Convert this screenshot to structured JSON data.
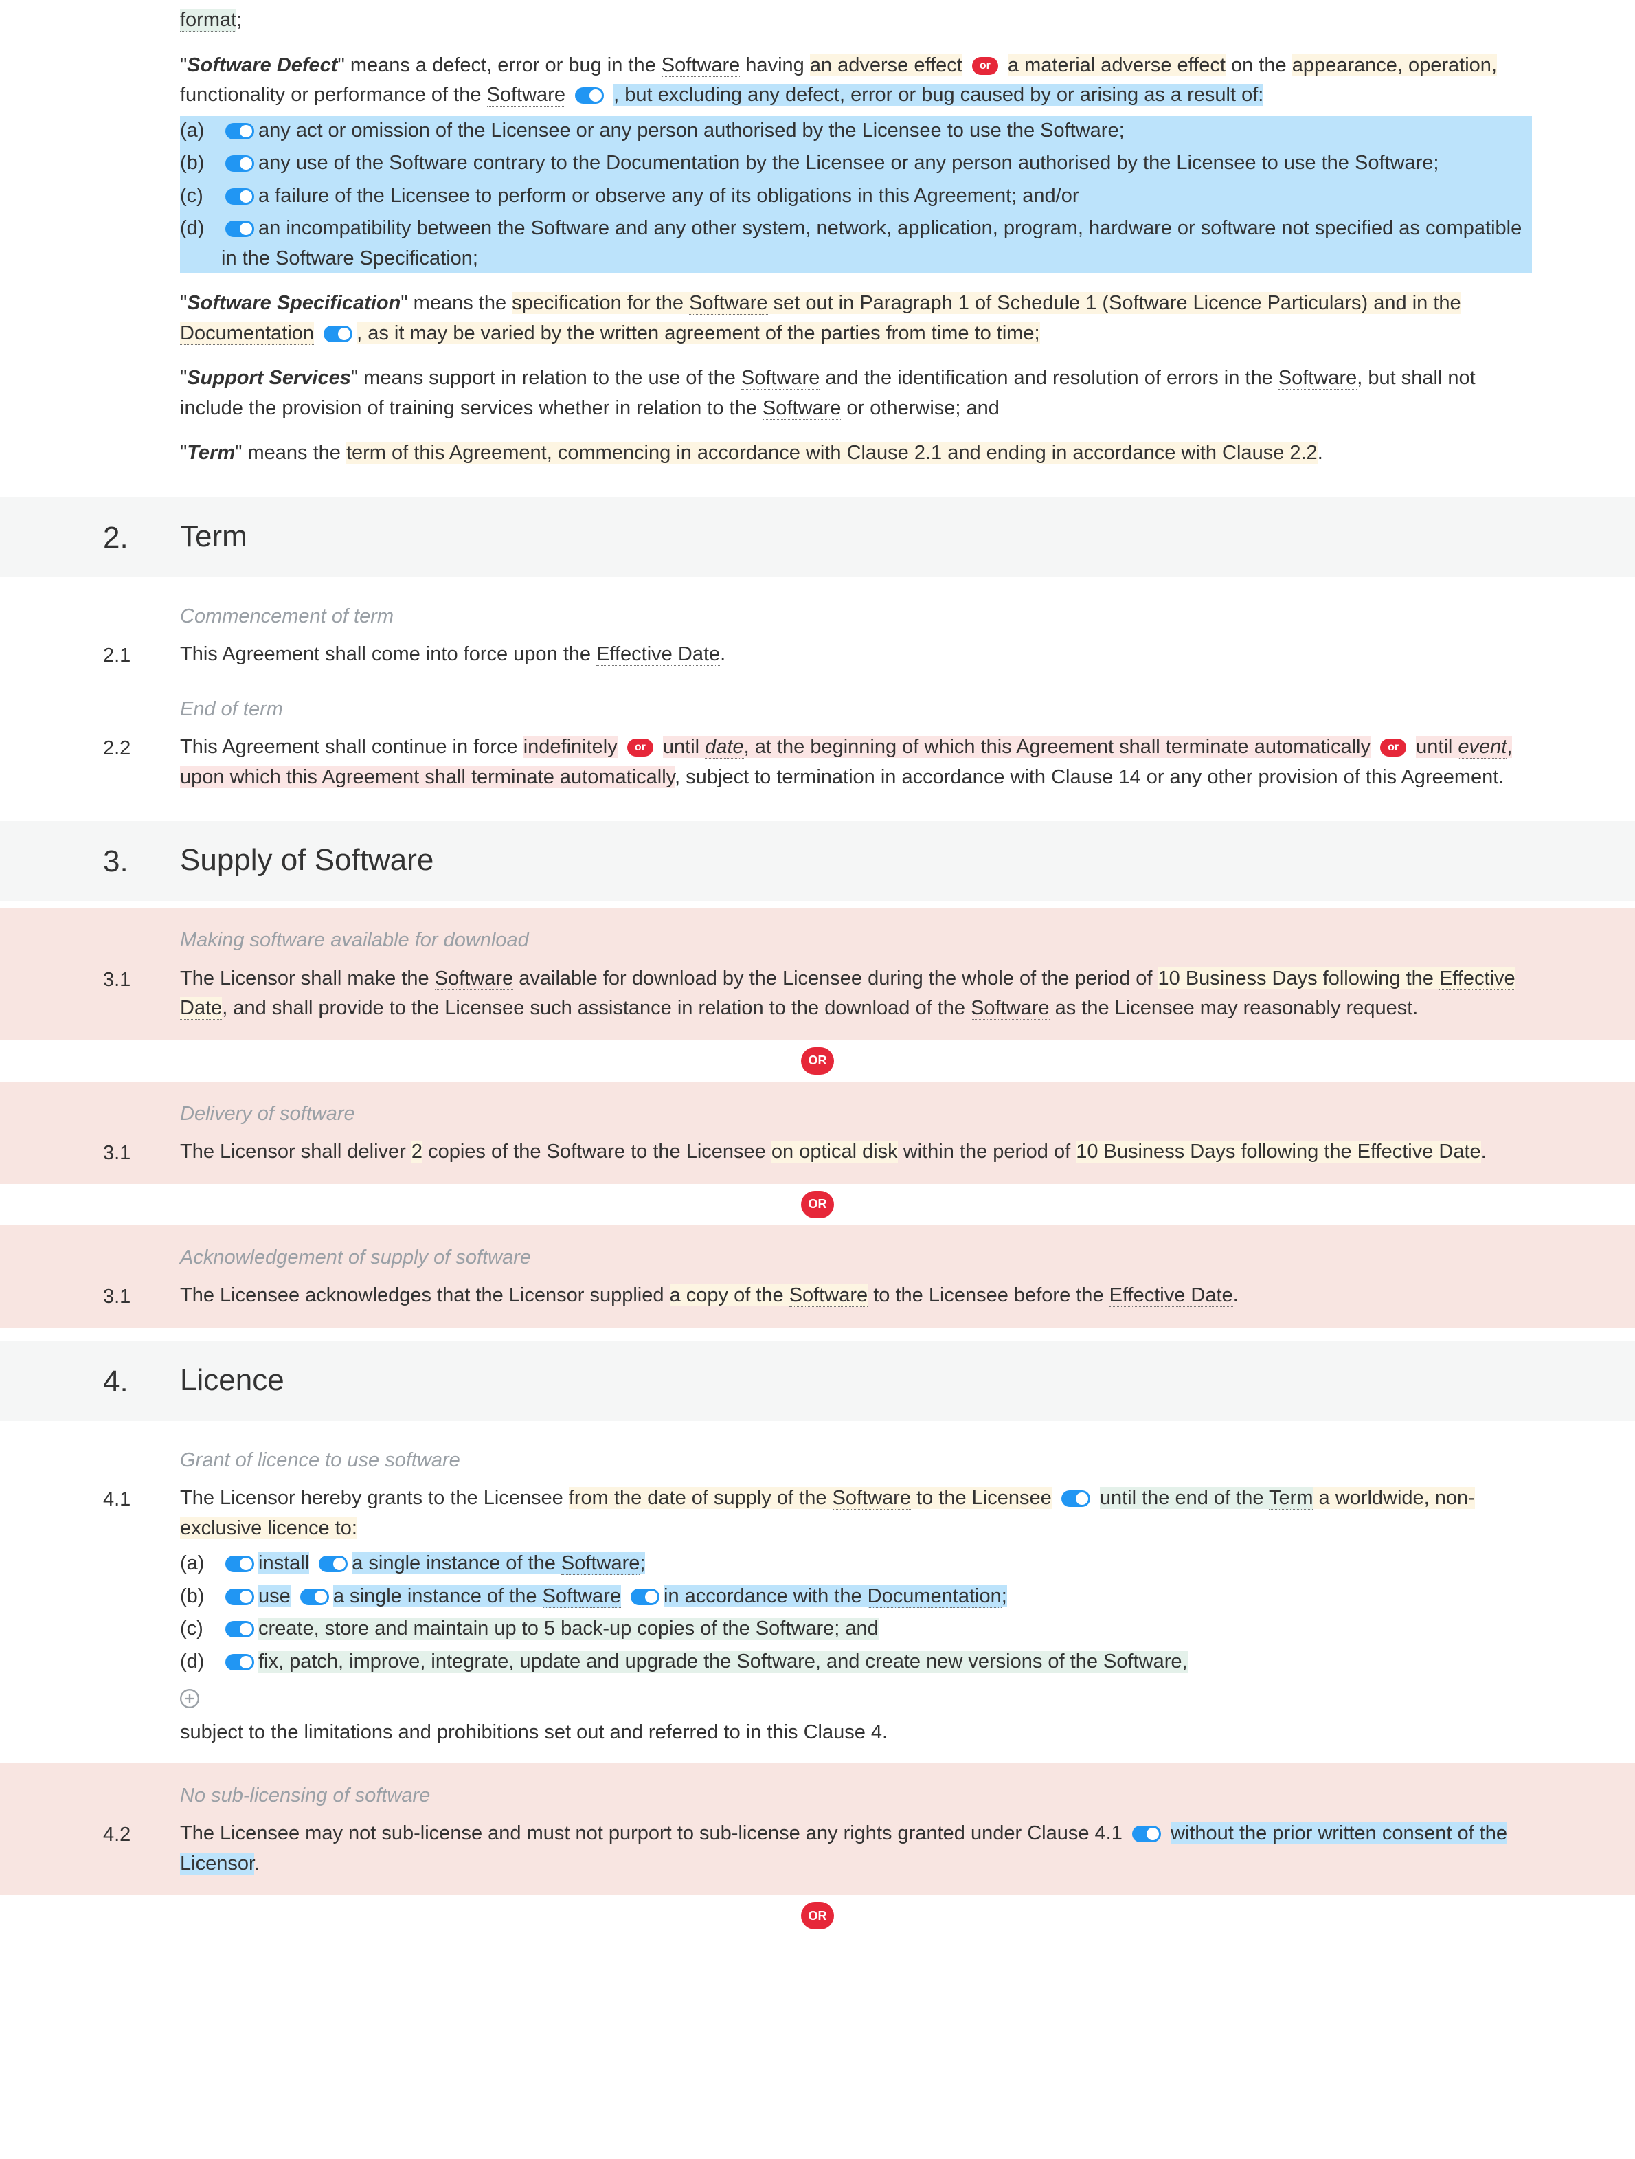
{
  "ui": {
    "or": "OR",
    "or_lc": "or"
  },
  "defs": {
    "format": "format",
    "sd": {
      "term": "Software Defect",
      "t1": "\" means a defect, error or bug in the ",
      "software1": "Software",
      "t2": " having ",
      "adverse": "an adverse effect",
      "material": "a material adverse effect",
      "t3": " on the ",
      "appearance": "appearance, operation,",
      "t4": " functionality or performance of the ",
      "software2": "Software",
      "t5": ", but excluding any defect, error or bug caused by or arising as a result of:",
      "a": {
        "label": "(a)",
        "text": "any act or omission of the Licensee or any person authorised by the Licensee to use the Software;"
      },
      "b": {
        "label": "(b)",
        "text": "any use of the Software contrary to the Documentation by the Licensee or any person authorised by the Licensee to use the Software;"
      },
      "c": {
        "label": "(c)",
        "text": "a failure of the Licensee to perform or observe any of its obligations in this Agreement; and/or"
      },
      "d": {
        "label": "(d)",
        "text": "an incompatibility between the Software and any other system, network, application, program, hardware or software not specified as compatible in the Software Specification;"
      }
    },
    "sspec": {
      "term": "Software Specification",
      "t1": "\" means the ",
      "spec": "specification for the ",
      "software": "Software",
      "setout": " set out in Paragraph 1 of Schedule 1 (Software Licence Particulars) and in the ",
      "doc": "Documentation",
      "t2": ", as it may be varied by the written agreement of the parties from time to time;"
    },
    "ss": {
      "term": "Support Services",
      "t1": "\" means support in relation to the use of the ",
      "sw1": "Software",
      "t2": " and the identification and resolution of errors in the ",
      "sw2": "Software",
      "t3": ", but shall not include the provision of training services whether in relation to the ",
      "sw3": "Software",
      "t4": " or otherwise; and"
    },
    "term": {
      "term": "Term",
      "t1": "\" means the ",
      "hl": "term of this Agreement, commencing in accordance with Clause 2.1 and ending in accordance with Clause 2.2",
      "t2": "."
    }
  },
  "s2": {
    "num": "2.",
    "title": "Term",
    "sub1": "Commencement of term",
    "c21": {
      "num": "2.1",
      "t1": "This Agreement shall come into force upon the ",
      "eff": "Effective Date",
      "t2": "."
    },
    "sub2": "End of term",
    "c22": {
      "num": "2.2",
      "t1": "This Agreement shall continue in force ",
      "indef": "indefinitely",
      "t2": " until ",
      "date": "date",
      "t3": ", at the beginning of which this Agreement shall terminate automatically",
      "t4": " until ",
      "event": "event",
      "t5": ", upon which this Agreement shall terminate automatically",
      "t6": ", subject to termination in accordance with Clause 14 or any other provision of this Agreement."
    }
  },
  "s3": {
    "num": "3.",
    "title_a": "Supply of ",
    "title_sw": "Software",
    "alt1": {
      "sub": "Making software available for download",
      "num": "3.1",
      "t1": "The Licensor shall make the ",
      "sw": "Software",
      "t2": " available for download by the Licensee during the whole of the period of ",
      "period": "10 Business Days following the ",
      "eff": "Effective Date",
      "t3": ", and shall provide to the Licensee such assistance in relation to the download of the ",
      "sw2": "Software",
      "t4": " as the Licensee may reasonably request."
    },
    "alt2": {
      "sub": "Delivery of software",
      "num": "3.1",
      "t1": "The Licensor shall deliver ",
      "copies": "2",
      "t2": " copies of the ",
      "sw": "Software",
      "t3": " to the Licensee ",
      "media": "on optical disk",
      "t4": " within the period of ",
      "period": "10 Business Days following the ",
      "eff": "Effective Date",
      "t5": "."
    },
    "alt3": {
      "sub": "Acknowledgement of supply of software",
      "num": "3.1",
      "t1": "The Licensee acknowledges that the Licensor supplied ",
      "copy": "a copy of the ",
      "sw": "Software",
      "t2": " to the Licensee before the ",
      "eff": "Effective Date",
      "t3": "."
    }
  },
  "s4": {
    "num": "4.",
    "title": "Licence",
    "sub1": "Grant of licence to use software",
    "c41": {
      "num": "4.1",
      "t1": "The Licensor hereby grants to the Licensee ",
      "from": "from the date of supply of the ",
      "sw": "Software",
      "tolic": " to the Licensee",
      "until1": " until the end of the ",
      "termword": "Term",
      "ww": " a worldwide, non-exclusive licence to:",
      "a": {
        "label": "(a)",
        "verb": "install",
        "obj": "a single instance of the ",
        "sw": "Software",
        "end": ";"
      },
      "b": {
        "label": "(b)",
        "verb": "use",
        "obj": "a single instance of the ",
        "sw": "Software",
        "acc": "in accordance with the ",
        "doc": "Documentation",
        "end": ";"
      },
      "c": {
        "label": "(c)",
        "text": "create, store and maintain up to 5 back-up copies of the ",
        "sw": "Software",
        "end": "; and"
      },
      "d": {
        "label": "(d)",
        "text": "fix, patch, improve, integrate, update and upgrade the ",
        "sw1": "Software",
        "text2": ", and create new versions of the ",
        "sw2": "Software",
        "end": ","
      },
      "tail": "subject to the limitations and prohibitions set out and referred to in this Clause 4."
    },
    "sub2": "No sub-licensing of software",
    "c42": {
      "num": "4.2",
      "t1": "The Licensee may not sub-license and must not purport to sub-license any rights granted under Clause 4.1 ",
      "wo": "without the prior written consent of the Licensor",
      "end": "."
    }
  }
}
